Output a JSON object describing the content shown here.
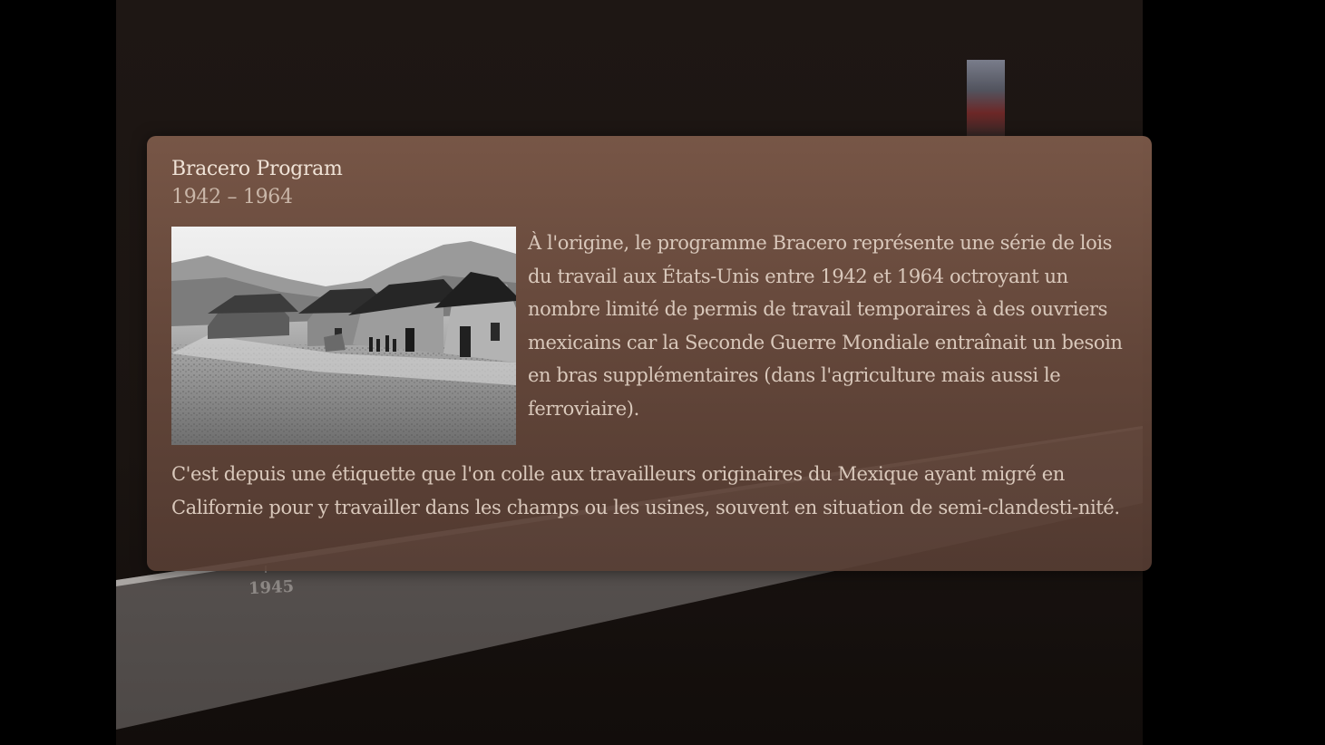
{
  "timeline": {
    "tick_labels": [
      "1945"
    ]
  },
  "background": {
    "far_heading": "",
    "far_text": ""
  },
  "card": {
    "title": "Bracero Program",
    "dates": "1942 – 1964",
    "image_alt": "Village houses photograph",
    "paragraph_1": "À l'origine, le programme Bracero représente une série de lois du travail aux États-Unis entre 1942 et 1964 octroyant un nombre limité de permis de travail temporaires à des ouvriers mexicains car la Seconde Guerre Mondiale entraînait un besoin en bras supplémentaires (dans l'agriculture mais aussi le ferroviaire).",
    "paragraph_2": "C'est depuis une étiquette que l'on colle aux travailleurs originaires du Mexique ayant migré en Californie pour y travailler dans les champs ou les usines, souvent en situation de semi-clandesti-nité."
  },
  "colors": {
    "card_background": "#7a5848",
    "title_text": "#efe2d6",
    "body_text": "#d9c8bb",
    "page_background": "#000000"
  }
}
